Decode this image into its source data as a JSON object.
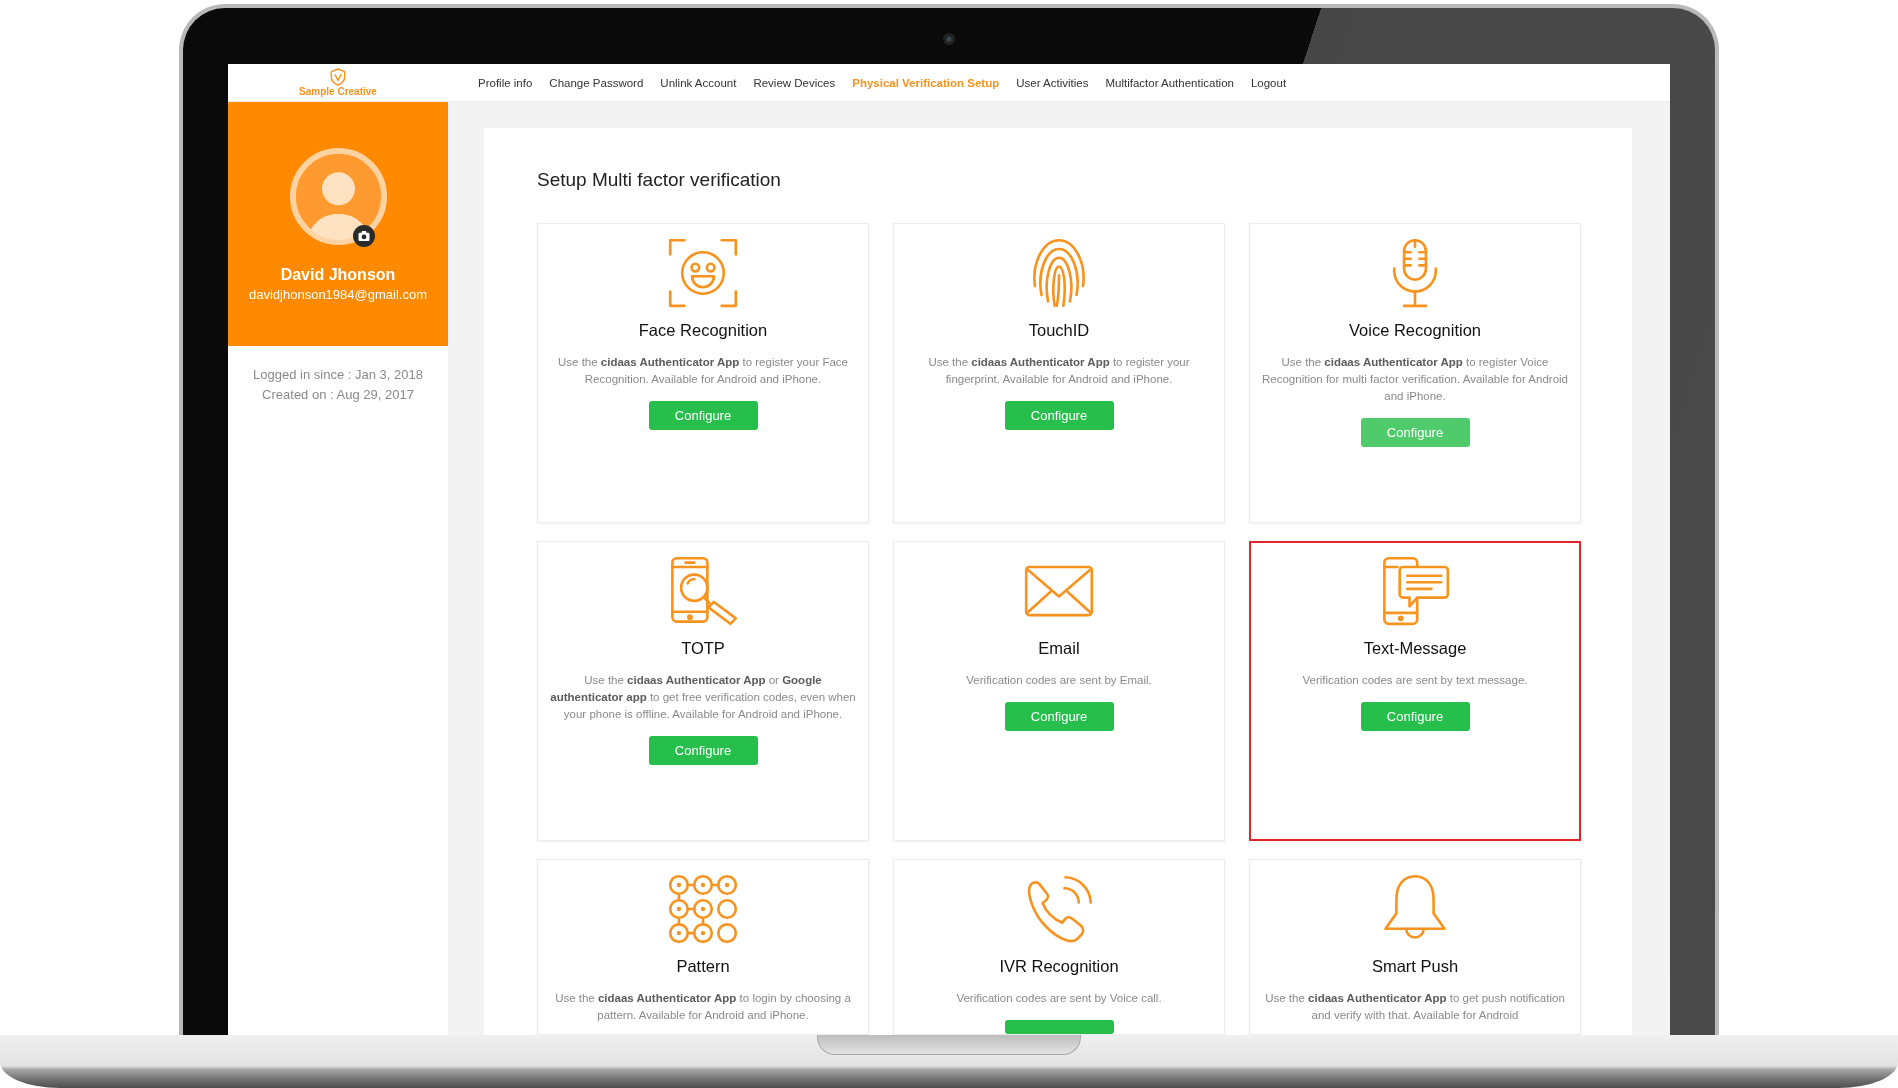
{
  "logo": {
    "text": "Sample Creative"
  },
  "nav": [
    {
      "label": "Profile info",
      "selected": false
    },
    {
      "label": "Change Password",
      "selected": false
    },
    {
      "label": "Unlink Account",
      "selected": false
    },
    {
      "label": "Review Devices",
      "selected": false
    },
    {
      "label": "Physical Verification Setup",
      "selected": true
    },
    {
      "label": "User Activities",
      "selected": false
    },
    {
      "label": "Multifactor Authentication",
      "selected": false
    },
    {
      "label": "Logout",
      "selected": false
    }
  ],
  "profile": {
    "name": "David Jhonson",
    "email": "davidjhonson1984@gmail.com",
    "logged_in": "Logged in since : Jan 3, 2018",
    "created": "Created on : Aug 29, 2017"
  },
  "content": {
    "title": "Setup Multi factor verification",
    "cards": [
      {
        "kind": "face",
        "title": "Face Recognition",
        "description": "Use the **cidaas Authenticator App** to register your Face Recognition. Available for Android and iPhone.",
        "button": {
          "label": "Configure",
          "hovered": false
        },
        "highlighted": false
      },
      {
        "kind": "touchid",
        "title": "TouchID",
        "description": "Use the **cidaas Authenticator App** to register your fingerprint. Available for Android and iPhone.",
        "button": {
          "label": "Configure",
          "hovered": false
        },
        "highlighted": false
      },
      {
        "kind": "voice",
        "title": "Voice Recognition",
        "description": "Use the **cidaas Authenticator App** to register Voice Recognition for multi factor verification. Available for Android and iPhone.",
        "button": {
          "label": "Configure",
          "hovered": true
        },
        "highlighted": false
      },
      {
        "kind": "totp",
        "title": "TOTP",
        "description": "Use the **cidaas Authenticator App** or **Google authenticator app** to get free verification codes, even when your phone is offline. Available for Android and iPhone.",
        "button": {
          "label": "Configure",
          "hovered": false
        },
        "highlighted": false
      },
      {
        "kind": "email",
        "title": "Email",
        "description": "Verification codes are sent by Email.",
        "button": {
          "label": "Configure",
          "hovered": false
        },
        "highlighted": false
      },
      {
        "kind": "sms",
        "title": "Text-Message",
        "description": "Verification codes are sent by text message.",
        "button": {
          "label": "Configure",
          "hovered": false
        },
        "highlighted": true
      },
      {
        "kind": "pattern",
        "title": "Pattern",
        "description": "Use the **cidaas Authenticator App** to login by choosing a pattern. Available for Android and iPhone.",
        "highlighted": false
      },
      {
        "kind": "ivr",
        "title": "IVR Recognition",
        "description": "Verification codes are sent by Voice call.",
        "button": {
          "hovered": false
        },
        "highlighted": false
      },
      {
        "kind": "push",
        "title": "Smart Push",
        "description": "Use the **cidaas Authenticator App** to get push notification and verify with that. Available for Android",
        "highlighted": false
      }
    ]
  }
}
